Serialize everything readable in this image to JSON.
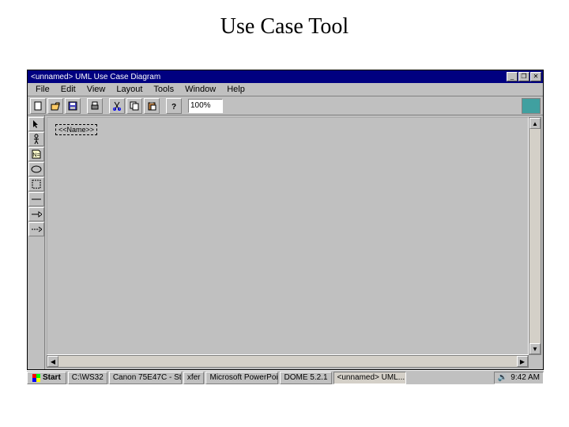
{
  "slide": {
    "title": "Use Case Tool"
  },
  "window": {
    "title": "<unnamed> UML Use Case Diagram",
    "controls": {
      "min": "_",
      "max": "❐",
      "close": "✕"
    }
  },
  "menu": {
    "items": [
      "File",
      "Edit",
      "View",
      "Layout",
      "Tools",
      "Window",
      "Help"
    ]
  },
  "toolbar": {
    "new": "new-icon",
    "open": "open-icon",
    "save": "save-icon",
    "print": "print-icon",
    "cut": "cut-icon",
    "copy": "copy-icon",
    "paste": "paste-icon",
    "help": "help-icon",
    "zoom": "100%"
  },
  "palette": {
    "items": [
      "pointer",
      "actor",
      "note",
      "usecase-oval",
      "system-box",
      "association",
      "generalization",
      "dependency"
    ]
  },
  "canvas": {
    "node_label": "<<Name>>"
  },
  "taskbar": {
    "start": "Start",
    "buttons": [
      "C:\\WS32",
      "Canon 75E47C - St",
      "xfer",
      "Microsoft PowerPoin",
      "DOME 5.2.1",
      "<unnamed> UML..."
    ],
    "time": "9:42 AM"
  }
}
